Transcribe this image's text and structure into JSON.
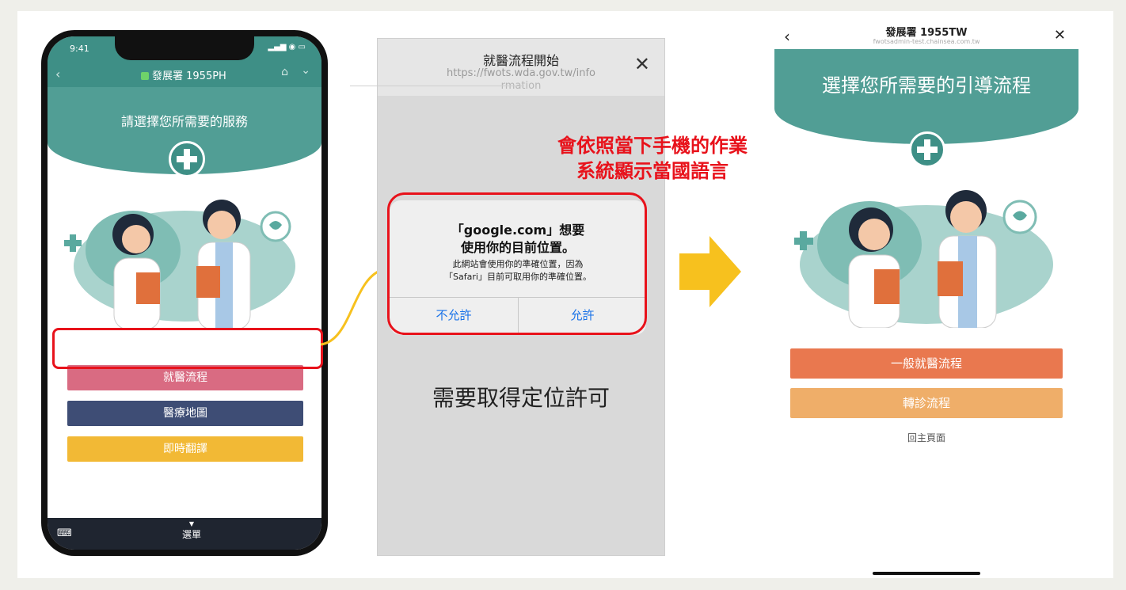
{
  "phone1": {
    "time": "9:41",
    "nav_title": "發展署 1955PH",
    "header_title": "請選擇您所需要的服務",
    "buttons": [
      {
        "label": "就醫流程",
        "color": "#d96b82"
      },
      {
        "label": "醫療地圖",
        "color": "#3e4d75"
      },
      {
        "label": "即時翻譯",
        "color": "#f2b935"
      }
    ],
    "bottom_menu": "選單"
  },
  "sheet": {
    "title": "就醫流程開始",
    "url_line1": "https://fwots.wda.gov.tw/info",
    "url_line2": "rmation",
    "alert_title_line1": "「google.com」想要",
    "alert_title_line2": "使用你的目前位置。",
    "alert_body_line1": "此網站會使用你的準確位置，因為",
    "alert_body_line2": "「Safari」目前可取用你的準確位置。",
    "deny_label": "不允許",
    "allow_label": "允許",
    "caption": "需要取得定位許可"
  },
  "annotation": {
    "line1": "會依照當下手機的作業",
    "line2": "系統顯示當國語言"
  },
  "phone3": {
    "title": "發展署 1955TW",
    "url": "fwotsadmin-test.chainsea.com.tw",
    "header_title": "選擇您所需要的引導流程",
    "buttons": [
      {
        "label": "一般就醫流程",
        "color": "#e9784f"
      },
      {
        "label": "轉診流程",
        "color": "#efae69"
      }
    ],
    "home_link": "回主頁面"
  },
  "colors": {
    "teal": "#519e95",
    "highlight_red": "#e8121b",
    "arrow_yellow": "#f7c11e",
    "ios_blue": "#1a73e8"
  }
}
